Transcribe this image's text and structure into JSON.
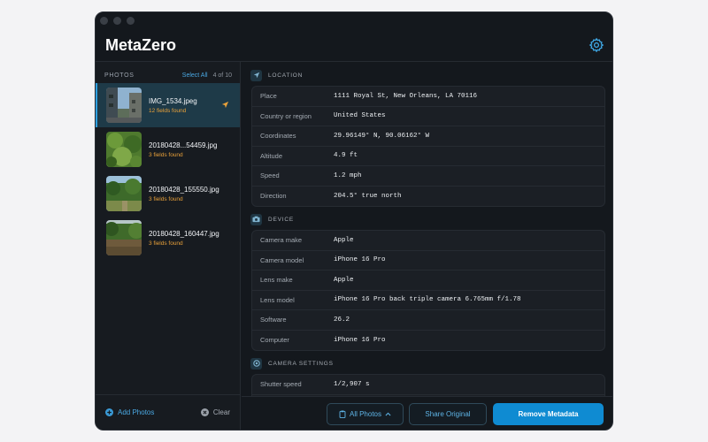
{
  "app": {
    "title": "MetaZero"
  },
  "sidebar": {
    "header_label": "PHOTOS",
    "select_all": "Select All",
    "count": "4 of 10",
    "photos": [
      {
        "name": "IMG_1534.jpeg",
        "fields": "12 fields found",
        "has_location": true
      },
      {
        "name": "20180428...54459.jpg",
        "fields": "3 fields found"
      },
      {
        "name": "20180428_155550.jpg",
        "fields": "3 fields found"
      },
      {
        "name": "20180428_160447.jpg",
        "fields": "3 fields found"
      }
    ],
    "add_label": "Add Photos",
    "clear_label": "Clear"
  },
  "sections": {
    "location": {
      "title": "LOCATION",
      "rows": [
        {
          "key": "Place",
          "value": "1111 Royal St, New Orleans, LA  70116"
        },
        {
          "key": "Country or region",
          "value": "United States"
        },
        {
          "key": "Coordinates",
          "value": "29.96149° N, 90.06162° W"
        },
        {
          "key": "Altitude",
          "value": "4.9 ft"
        },
        {
          "key": "Speed",
          "value": "1.2 mph"
        },
        {
          "key": "Direction",
          "value": "204.5° true north"
        }
      ]
    },
    "device": {
      "title": "DEVICE",
      "rows": [
        {
          "key": "Camera make",
          "value": "Apple"
        },
        {
          "key": "Camera model",
          "value": "iPhone 16 Pro"
        },
        {
          "key": "Lens make",
          "value": "Apple"
        },
        {
          "key": "Lens model",
          "value": "iPhone 16 Pro back triple camera 6.765mm f/1.78"
        },
        {
          "key": "Software",
          "value": "26.2"
        },
        {
          "key": "Computer",
          "value": "iPhone 16 Pro"
        }
      ]
    },
    "camera": {
      "title": "CAMERA SETTINGS",
      "rows": [
        {
          "key": "Shutter speed",
          "value": "1/2,907 s"
        },
        {
          "key": "",
          "value": ""
        }
      ]
    }
  },
  "footer": {
    "scope_label": "All Photos",
    "share_label": "Share Original",
    "remove_label": "Remove Metadata"
  },
  "colors": {
    "accent": "#0f8bd2",
    "link": "#4aa8e2",
    "fields_found": "#e9a13a",
    "background": "#14181d"
  }
}
